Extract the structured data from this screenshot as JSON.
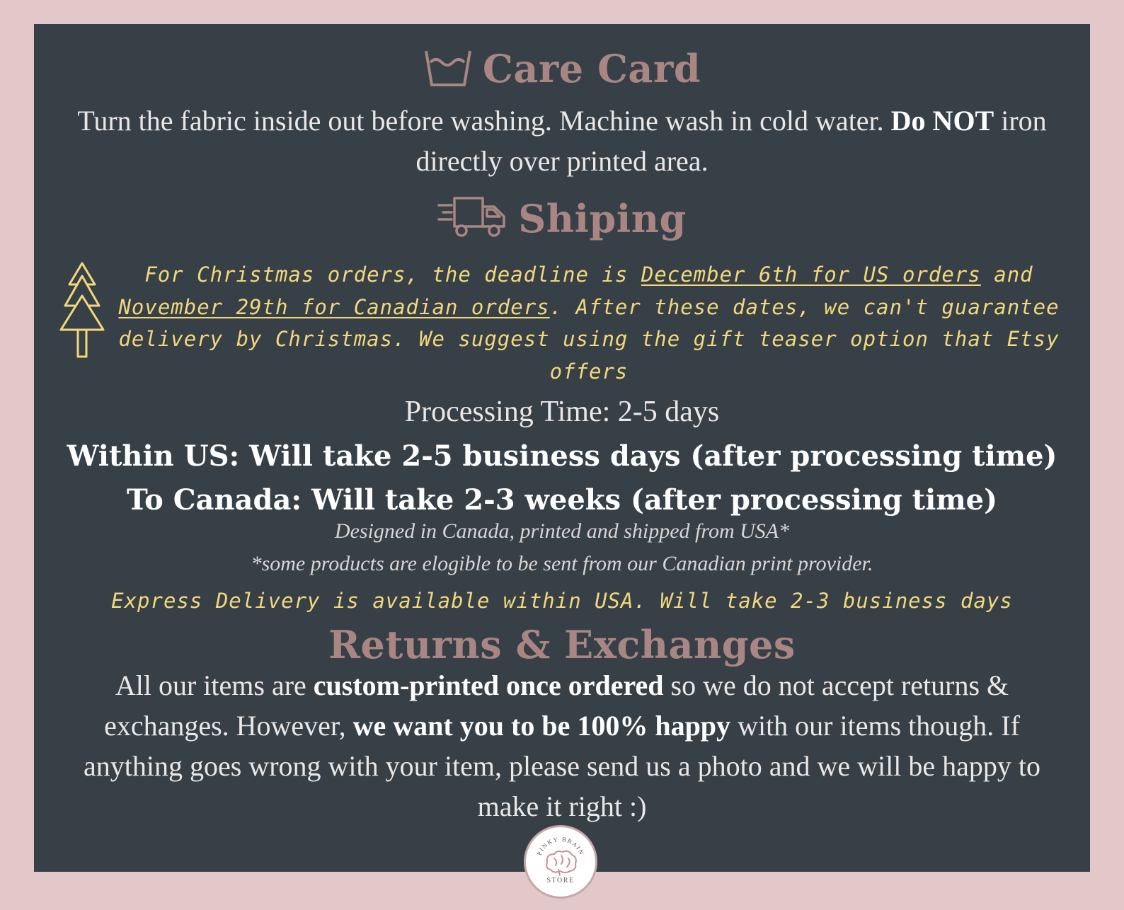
{
  "care": {
    "title": "Care Card",
    "icon": "wash-basin-icon",
    "text_1": "Turn the fabric inside out before washing. Machine wash in cold water.",
    "bold_1": "Do NOT",
    "text_2": "iron directly over printed area."
  },
  "shipping": {
    "title": "Shiping",
    "icon": "delivery-truck-icon",
    "christmas": {
      "icon": "christmas-tree-icon",
      "part_1": "For Christmas orders, the deadline is",
      "us_deadline": "December 6th for US orders",
      "part_2": "and",
      "ca_deadline": "November 29th for Canadian orders",
      "part_3": ". After these dates, we can't guarantee delivery by Christmas. We suggest using the gift teaser option that Etsy offers"
    },
    "processing": "Processing Time: 2-5 days",
    "within_us": "Within US: Will take 2-5 business days (after processing time)",
    "to_canada": "To Canada: Will take 2-3 weeks (after processing time)",
    "designed": "Designed in Canada, printed and shipped from USA*",
    "note": "*some products are elogible to be sent from our Canadian print provider.",
    "express": "Express Delivery is available within USA. Will take 2-3 business days"
  },
  "returns": {
    "title": "Returns & Exchanges",
    "text_1": "All our items are",
    "bold_1": "custom-printed once ordered",
    "text_2": "so we do not accept returns & exchanges. However,",
    "bold_2": "we want you to be 100% happy",
    "text_3": "with our items though. If anything goes wrong with your item, please send us a photo and we will be happy to make it right :)"
  },
  "logo": {
    "top_text": "PINKY BRAIN",
    "bottom_text": "STORE",
    "icon": "brain-icon"
  },
  "colors": {
    "background": "#e2c8c9",
    "card": "#374047",
    "heading": "#a98683",
    "highlight": "#f3d77d"
  }
}
